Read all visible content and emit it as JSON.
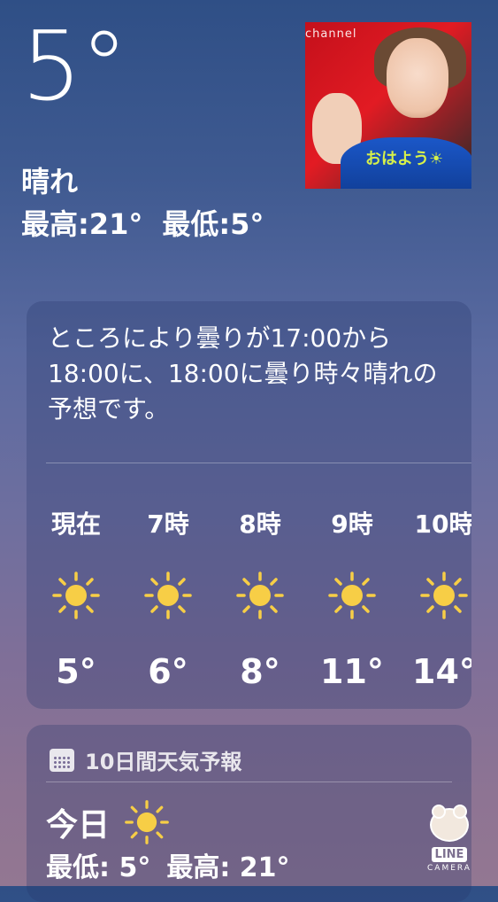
{
  "current": {
    "temperature": "5°",
    "condition": "晴れ",
    "high": "最高:21°",
    "low": "最低:5°"
  },
  "photo": {
    "channel_text": "channel",
    "greeting": "おはよう☀"
  },
  "hourly_card": {
    "summary": "ところにより曇りが17:00から18:00に、18:00に曇り時々晴れの予想です。",
    "hours": [
      {
        "label": "現在",
        "icon": "sun-icon",
        "temp": "5°"
      },
      {
        "label": "7時",
        "icon": "sun-icon",
        "temp": "6°"
      },
      {
        "label": "8時",
        "icon": "sun-icon",
        "temp": "8°"
      },
      {
        "label": "9時",
        "icon": "sun-icon",
        "temp": "11°"
      },
      {
        "label": "10時",
        "icon": "sun-icon",
        "temp": "14°"
      }
    ]
  },
  "forecast_card": {
    "title": "10日間天気予報",
    "title_icon": "calendar-icon",
    "today": {
      "label": "今日",
      "icon": "sun-icon",
      "low": "最低: 5°",
      "high": "最高: 21°"
    }
  },
  "watermark": {
    "brand": "LINE",
    "sub": "CAMERA"
  },
  "colors": {
    "sun": "#F7CE46",
    "gradient_top": "#2f4f86",
    "gradient_bottom": "#937792"
  }
}
